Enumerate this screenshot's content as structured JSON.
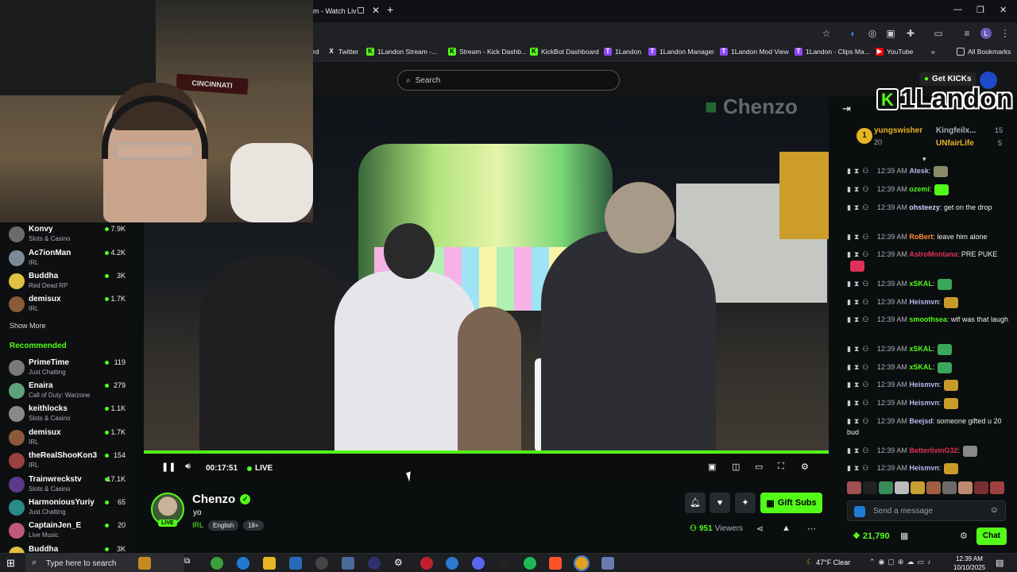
{
  "browser": {
    "tab_title": "m - Watch Liv",
    "bookmarks": [
      {
        "label": "rd",
        "icon": "bookmark-icon"
      },
      {
        "label": "Twitter",
        "icon": "x-icon"
      },
      {
        "label": "1Landon Stream -...",
        "icon": "kick-icon"
      },
      {
        "label": "Stream - Kick Dashb...",
        "icon": "kick-icon"
      },
      {
        "label": "KickBot Dashboard",
        "icon": "kick-icon"
      },
      {
        "label": "1Landon",
        "icon": "twitch-icon"
      },
      {
        "label": "1Landon Manager",
        "icon": "twitch-icon"
      },
      {
        "label": "1Landon Mod View",
        "icon": "twitch-icon"
      },
      {
        "label": "1Landon - Clips Ma...",
        "icon": "twitch-icon"
      },
      {
        "label": "YouTube",
        "icon": "youtube-icon"
      }
    ],
    "all_bookmarks": "All Bookmarks",
    "profile_initial": "L"
  },
  "kick": {
    "search_placeholder": "Search",
    "get_kicks": "Get KICKs"
  },
  "webcam": {
    "banner_text": "CINCINNATI"
  },
  "sidebar": {
    "following": [
      {
        "name": "Konvy",
        "category": "Slots & Casino",
        "viewers": "7.9K",
        "color": "#6b6b6b"
      },
      {
        "name": "Ac7ionMan",
        "category": "IRL",
        "viewers": "4.2K",
        "color": "#7b8a98"
      },
      {
        "name": "Buddha",
        "category": "Red Dead RP",
        "viewers": "3K",
        "color": "#e0c040"
      },
      {
        "name": "demisux",
        "category": "IRL",
        "viewers": "1.7K",
        "color": "#8a5a3a"
      }
    ],
    "show_more": "Show More",
    "recommended_header": "Recommended",
    "recommended": [
      {
        "name": "PrimeTime",
        "category": "Just Chatting",
        "viewers": "119",
        "color": "#7a7a7a"
      },
      {
        "name": "Enaira",
        "category": "Call of Duty: Warzone",
        "viewers": "279",
        "color": "#5fa37a"
      },
      {
        "name": "keithlocks",
        "category": "Slots & Casino",
        "viewers": "1.1K",
        "color": "#888"
      },
      {
        "name": "demisux",
        "category": "IRL",
        "viewers": "1.7K",
        "color": "#8a5a3a"
      },
      {
        "name": "theRealShooKon3",
        "category": "IRL",
        "viewers": "154",
        "color": "#9a4040"
      },
      {
        "name": "Trainwreckstv",
        "category": "Slots & Casino",
        "viewers": "17.1K",
        "color": "#5a3a8a"
      },
      {
        "name": "HarmoniousYuriy",
        "category": "Just Chatting",
        "viewers": "65",
        "color": "#2a8a8a"
      },
      {
        "name": "CaptainJen_E",
        "category": "Live Music",
        "viewers": "20",
        "color": "#c05a7a"
      },
      {
        "name": "Buddha",
        "category": "",
        "viewers": "3K",
        "color": "#e0c040"
      }
    ]
  },
  "video": {
    "overlay_logo": "Chenzo",
    "timecode": "00:17:51",
    "live_label": "LIVE",
    "progress": 1.0
  },
  "stream": {
    "name": "Chenzo",
    "title": "yo",
    "category": "IRL",
    "tags": [
      "English",
      "18+"
    ],
    "live_badge": "LIVE",
    "viewer_count": "951",
    "viewers_label": "Viewers",
    "gift_subs": "Gift Subs"
  },
  "chat": {
    "channel_logo": "1Landon",
    "leaderboard": {
      "rank": "1",
      "top_name": "yungswisher",
      "top_count": "20",
      "entries": [
        {
          "name": "Kingfeilx...",
          "count": "15"
        },
        {
          "name": "UNfairLife",
          "count": "5"
        }
      ]
    },
    "messages": [
      {
        "time": "12:39 AM",
        "user": "Atesk",
        "text": "",
        "color": "#b6b6f0",
        "emote": "#8a8a6a"
      },
      {
        "time": "12:39 AM",
        "user": "ozemi",
        "text": "",
        "color": "#53fc18",
        "emote": "#53fc18"
      },
      {
        "time": "12:39 AM",
        "user": "ohsteezy",
        "text": " get on the drop",
        "color": "#d0d0ff",
        "emote": ""
      },
      {
        "time": "12:39 AM",
        "user": "RoBert",
        "text": " leave him alone",
        "color": "#ff8c3a",
        "emote": ""
      },
      {
        "time": "12:39 AM",
        "user": "AstroMontana",
        "text": " PRE PUKE",
        "color": "#e0315a",
        "emote": "#e0315a"
      },
      {
        "time": "12:39 AM",
        "user": "xSKAL",
        "text": "",
        "color": "#53fc18",
        "emote": "#3aa85a"
      },
      {
        "time": "12:39 AM",
        "user": "Heismvn",
        "text": "",
        "color": "#b6b6f0",
        "emote": "#c89b2b"
      },
      {
        "time": "12:39 AM",
        "user": "smoothsea",
        "text": " wtf was that laugh",
        "color": "#53fc18",
        "emote": ""
      },
      {
        "time": "12:39 AM",
        "user": "xSKAL",
        "text": "",
        "color": "#53fc18",
        "emote": "#3aa85a"
      },
      {
        "time": "12:39 AM",
        "user": "xSKAL",
        "text": "",
        "color": "#53fc18",
        "emote": "#3aa85a"
      },
      {
        "time": "12:39 AM",
        "user": "Heismvn",
        "text": "",
        "color": "#b6b6f0",
        "emote": "#c89b2b"
      },
      {
        "time": "12:39 AM",
        "user": "Heismvn",
        "text": "",
        "color": "#b6b6f0",
        "emote": "#c89b2b"
      },
      {
        "time": "12:39 AM",
        "user": "Beejsd",
        "text": " someone gifted u 20 bud",
        "color": "#b6b6f0",
        "emote": ""
      },
      {
        "time": "12:39 AM",
        "user": "BetterlivinG32",
        "text": "",
        "color": "#e0315a",
        "emote": "#888"
      },
      {
        "time": "12:39 AM",
        "user": "Heismvn",
        "text": "",
        "color": "#b6b6f0",
        "emote": "#c89b2b"
      }
    ],
    "input_placeholder": "Send a message",
    "kicks_balance": "21,790",
    "send_label": "Chat"
  },
  "taskbar": {
    "search_placeholder": "Type here to search",
    "weather": "47°F  Clear",
    "time": "12:39 AM",
    "date": "10/10/2025"
  }
}
